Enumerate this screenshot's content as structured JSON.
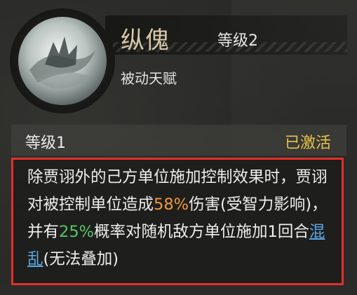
{
  "skill": {
    "name": "纵傀",
    "level": "等级2",
    "type": "被动天赋",
    "icon": "puppet-skill-icon"
  },
  "level_entry": {
    "label": "等级1",
    "status": "已激活",
    "status_color": "#e8c24a"
  },
  "description": {
    "seg1": "除贾诩外的己方单位施加控制效果时，贾诩对被控制单位造成",
    "pct_damage": "58%",
    "seg2": "伤害(受智力影响)，并有",
    "pct_chance": "25%",
    "seg3": "概率对随机敌方单位施加1回合",
    "status_link": "混乱",
    "seg4": "(无法叠加)"
  },
  "colors": {
    "damage_highlight": "#f09a3a",
    "chance_highlight": "#55c76a",
    "link": "#5aa8e8",
    "box_border": "#e0302a"
  }
}
